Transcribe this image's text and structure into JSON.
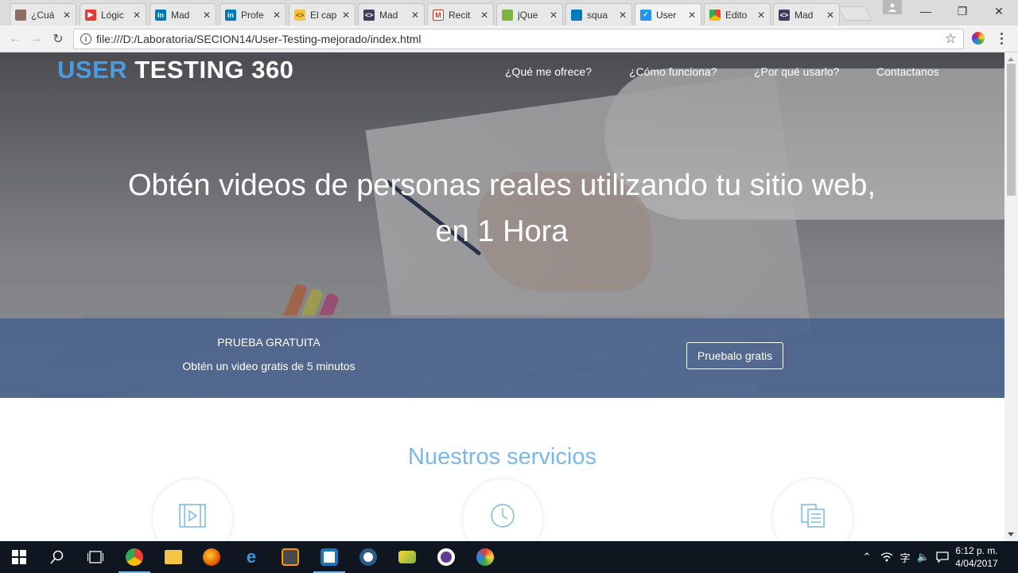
{
  "browser": {
    "tabs": [
      {
        "label": "¿Cuá",
        "favicon": "coffee-cup-icon",
        "color": "#8d6e63"
      },
      {
        "label": "Lógic",
        "favicon": "youtube-icon",
        "color": "#e53935"
      },
      {
        "label": "Mad",
        "favicon": "linkedin-icon",
        "color": "#0077b5"
      },
      {
        "label": "Profe",
        "favicon": "linkedin-icon",
        "color": "#0077b5"
      },
      {
        "label": "El cap",
        "favicon": "code-bracket-icon",
        "color": "#f5c242"
      },
      {
        "label": "Mad",
        "favicon": "code-editor-icon",
        "color": "#3d3d5c"
      },
      {
        "label": "Recit",
        "favicon": "gmail-icon",
        "color": "#d93025"
      },
      {
        "label": "jQue",
        "favicon": "jquery-icon",
        "color": "#7cb342"
      },
      {
        "label": "squa",
        "favicon": "trello-icon",
        "color": "#0079bf"
      },
      {
        "label": "User",
        "favicon": "checkbox-icon",
        "color": "#2196f3"
      },
      {
        "label": "Edito",
        "favicon": "chrome-icon",
        "color": "#f4b400"
      },
      {
        "label": "Mad",
        "favicon": "code-editor-icon",
        "color": "#3d3d5c"
      }
    ],
    "active_tab_index": 9,
    "url": "file:///D:/Laboratoria/SECION14/User-Testing-mejorado/index.html",
    "window_controls": {
      "minimize": "—",
      "restore": "❐",
      "close": "✕"
    }
  },
  "page": {
    "brand": {
      "accent": "USER",
      "main": " TESTING 360",
      "accent_color": "#4b9be0"
    },
    "nav": [
      "¿Qué me ofrece?",
      "¿Cómo funciona?",
      "¿Por qué usarlo?",
      "Contactanos"
    ],
    "headline": "Obtén videos de personas reales utilizando tu sitio web, en 1 Hora",
    "trial": {
      "title": "PRUEBA GRATUITA",
      "subtitle": "Obtén un video gratis de 5 minutos",
      "button": "Pruebalo gratis"
    },
    "services": {
      "title": "Nuestros servicios",
      "icons": [
        "video-file-icon",
        "clock-icon",
        "documents-icon"
      ],
      "title_color": "#7ab8ec"
    }
  },
  "taskbar": {
    "apps": [
      "start-icon",
      "search-icon",
      "task-view-icon",
      "chrome-icon",
      "file-explorer-icon",
      "firefox-icon",
      "edge-icon",
      "sublime-text-icon",
      "brackets-icon",
      "git-icon",
      "folder-sync-icon",
      "slack-icon",
      "paint-icon"
    ],
    "time": "6:12 p. m.",
    "date": "4/04/2017"
  }
}
